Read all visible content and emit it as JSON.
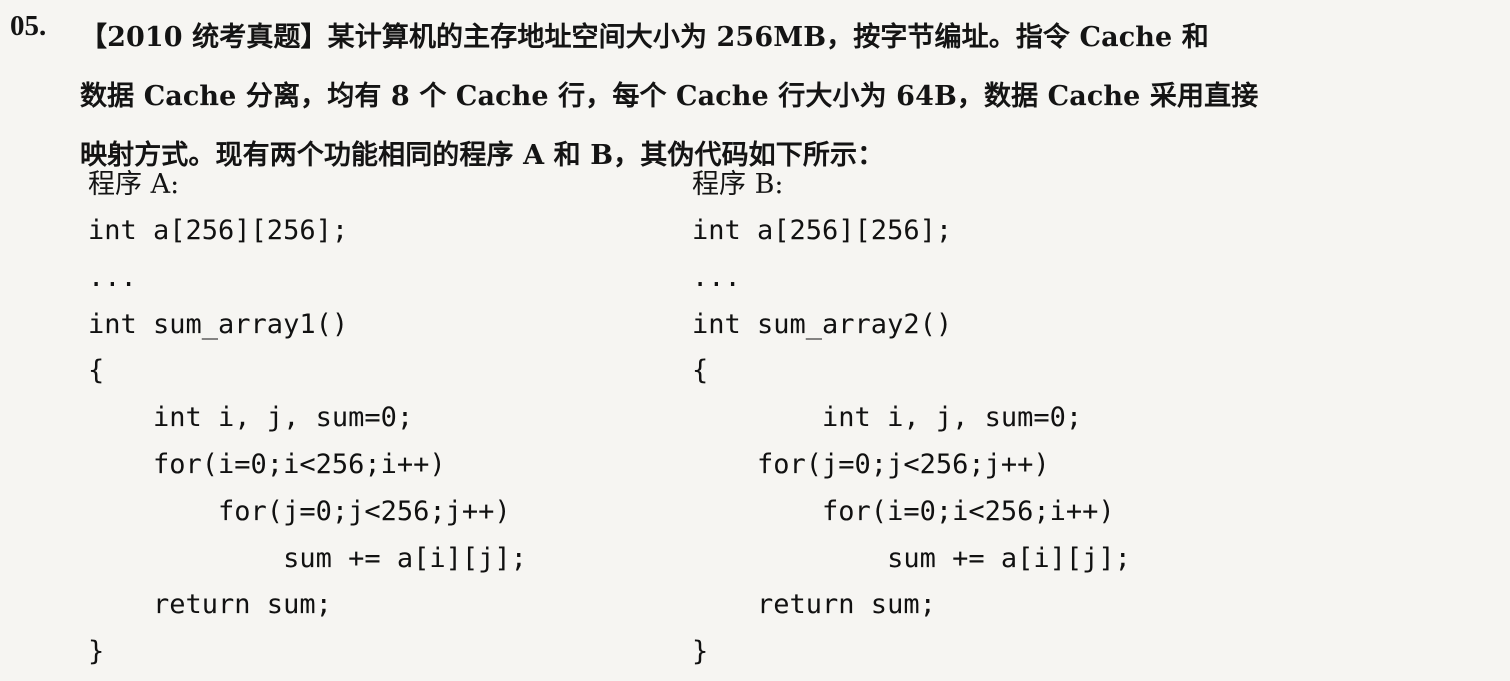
{
  "question": {
    "number": "05.",
    "lines": [
      "【2010 统考真题】某计算机的主存地址空间大小为 256MB，按字节编址。指令 Cache 和",
      "数据 Cache 分离，均有 8 个 Cache 行，每个 Cache 行大小为 64B，数据 Cache 采用直接",
      "映射方式。现有两个功能相同的程序 A 和 B，其伪代码如下所示："
    ]
  },
  "programs": [
    {
      "label": "程序 A:",
      "lines": [
        "int a[256][256];",
        "...",
        "int sum_array1()",
        "{",
        "    int i, j, sum=0;",
        "    for(i=0;i<256;i++)",
        "        for(j=0;j<256;j++)",
        "            sum += a[i][j];",
        "    return sum;",
        "}"
      ]
    },
    {
      "label": "程序 B:",
      "lines": [
        "int a[256][256];",
        "...",
        "int sum_array2()",
        "{",
        "        int i, j, sum=0;",
        "    for(j=0;j<256;j++)",
        "        for(i=0;i<256;i++)",
        "            sum += a[i][j];",
        "    return sum;",
        "}"
      ]
    }
  ]
}
